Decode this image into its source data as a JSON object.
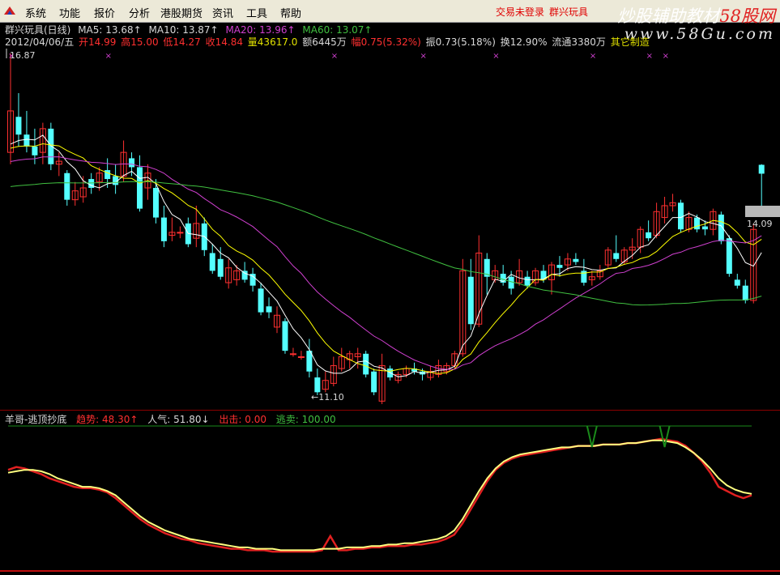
{
  "menu": {
    "items": [
      "系统",
      "功能",
      "报价",
      "分析",
      "港股期货",
      "资讯",
      "工具",
      "帮助"
    ],
    "status": "交易未登录",
    "stock_name": "群兴玩具"
  },
  "watermark": {
    "line1_a": "炒股辅助教材",
    "line1_b": "58股网",
    "line2": "www.58Gu.com"
  },
  "header": {
    "title": "群兴玩具(日线)",
    "ma5": "MA5: 13.68↑",
    "ma10": "MA10: 13.87↑",
    "ma20": "MA20: 13.96↑",
    "ma60": "MA60: 13.07↑"
  },
  "quote": {
    "date": "2012/04/06/五",
    "open": "开14.99",
    "high": "高15.00",
    "low": "低14.27",
    "close": "收14.84",
    "volume": "量43617.0",
    "amount": "额6445万",
    "change": "幅0.75(5.32%)",
    "amplitude": "振0.73(5.18%)",
    "turnover": "换12.90%",
    "float": "流通3380万",
    "sector": "其它制造"
  },
  "price_labels": {
    "high_mark": "16.87",
    "low_mark": "←11.10",
    "current": "14.09"
  },
  "indicator": {
    "name": "羊哥-逃顶抄底",
    "trend": "趋势: 48.30↑",
    "popularity": "人气: 51.80↓",
    "exit": "出击: 0.00",
    "sell": "逃卖: 100.00"
  },
  "colors": {
    "up": "#ff3030",
    "down": "#54ffff",
    "ma5": "#ffffff",
    "ma10": "#ffff00",
    "ma20": "#d040d0",
    "ma60": "#40c040",
    "trend_line": "#e02020",
    "popularity_line": "#ffff80"
  },
  "chart_data": {
    "type": "candlestick",
    "price_range": [
      11.1,
      16.87
    ],
    "candles": [
      {
        "o": 15.2,
        "h": 16.87,
        "l": 15.0,
        "c": 15.9
      },
      {
        "o": 15.8,
        "h": 16.2,
        "l": 15.3,
        "c": 15.5
      },
      {
        "o": 15.5,
        "h": 15.9,
        "l": 15.2,
        "c": 15.3
      },
      {
        "o": 15.3,
        "h": 15.6,
        "l": 15.0,
        "c": 15.15
      },
      {
        "o": 15.2,
        "h": 15.7,
        "l": 15.0,
        "c": 15.6
      },
      {
        "o": 15.6,
        "h": 15.7,
        "l": 14.9,
        "c": 15.0
      },
      {
        "o": 15.0,
        "h": 15.2,
        "l": 14.8,
        "c": 15.05
      },
      {
        "o": 14.85,
        "h": 14.9,
        "l": 14.3,
        "c": 14.4
      },
      {
        "o": 14.4,
        "h": 14.7,
        "l": 14.3,
        "c": 14.55
      },
      {
        "o": 14.45,
        "h": 14.8,
        "l": 14.35,
        "c": 14.6
      },
      {
        "o": 14.75,
        "h": 14.85,
        "l": 14.5,
        "c": 14.6
      },
      {
        "o": 14.7,
        "h": 14.95,
        "l": 14.55,
        "c": 14.85
      },
      {
        "o": 14.9,
        "h": 15.1,
        "l": 14.6,
        "c": 14.75
      },
      {
        "o": 14.8,
        "h": 15.0,
        "l": 14.5,
        "c": 14.65
      },
      {
        "o": 14.8,
        "h": 15.4,
        "l": 14.7,
        "c": 15.2
      },
      {
        "o": 15.1,
        "h": 15.2,
        "l": 14.8,
        "c": 14.95
      },
      {
        "o": 14.95,
        "h": 15.15,
        "l": 14.2,
        "c": 14.25
      },
      {
        "o": 14.6,
        "h": 15.0,
        "l": 14.4,
        "c": 14.85
      },
      {
        "o": 14.6,
        "h": 14.75,
        "l": 14.0,
        "c": 14.1
      },
      {
        "o": 14.1,
        "h": 14.3,
        "l": 13.6,
        "c": 13.7
      },
      {
        "o": 13.8,
        "h": 14.1,
        "l": 13.7,
        "c": 13.85
      },
      {
        "o": 13.85,
        "h": 13.95,
        "l": 13.75,
        "c": 13.85
      },
      {
        "o": 14.0,
        "h": 14.1,
        "l": 13.6,
        "c": 13.65
      },
      {
        "o": 13.75,
        "h": 14.3,
        "l": 13.6,
        "c": 14.0
      },
      {
        "o": 14.0,
        "h": 14.1,
        "l": 13.45,
        "c": 13.55
      },
      {
        "o": 13.5,
        "h": 13.65,
        "l": 13.15,
        "c": 13.2
      },
      {
        "o": 13.4,
        "h": 13.6,
        "l": 13.05,
        "c": 13.1
      },
      {
        "o": 13.0,
        "h": 13.4,
        "l": 12.9,
        "c": 13.25
      },
      {
        "o": 13.05,
        "h": 13.3,
        "l": 12.95,
        "c": 13.2
      },
      {
        "o": 13.2,
        "h": 13.35,
        "l": 13.0,
        "c": 13.05
      },
      {
        "o": 13.15,
        "h": 13.25,
        "l": 12.85,
        "c": 12.95
      },
      {
        "o": 12.9,
        "h": 13.0,
        "l": 12.45,
        "c": 12.5
      },
      {
        "o": 12.6,
        "h": 12.75,
        "l": 12.4,
        "c": 12.5
      },
      {
        "o": 12.25,
        "h": 12.6,
        "l": 12.15,
        "c": 12.45
      },
      {
        "o": 12.35,
        "h": 12.4,
        "l": 11.8,
        "c": 11.85
      },
      {
        "o": 11.8,
        "h": 11.9,
        "l": 11.75,
        "c": 11.8
      },
      {
        "o": 11.75,
        "h": 11.85,
        "l": 11.7,
        "c": 11.75
      },
      {
        "o": 11.85,
        "h": 12.05,
        "l": 11.4,
        "c": 11.5
      },
      {
        "o": 11.4,
        "h": 11.55,
        "l": 11.1,
        "c": 11.15
      },
      {
        "o": 11.2,
        "h": 11.5,
        "l": 11.15,
        "c": 11.35
      },
      {
        "o": 11.3,
        "h": 11.75,
        "l": 11.25,
        "c": 11.6
      },
      {
        "o": 11.55,
        "h": 11.9,
        "l": 11.5,
        "c": 11.75
      },
      {
        "o": 11.7,
        "h": 11.85,
        "l": 11.55,
        "c": 11.8
      },
      {
        "o": 11.75,
        "h": 11.9,
        "l": 11.55,
        "c": 11.8
      },
      {
        "o": 11.8,
        "h": 11.85,
        "l": 11.4,
        "c": 11.45
      },
      {
        "o": 11.5,
        "h": 11.55,
        "l": 11.1,
        "c": 11.15
      },
      {
        "o": 11.0,
        "h": 11.8,
        "l": 10.95,
        "c": 11.6
      },
      {
        "o": 11.55,
        "h": 11.6,
        "l": 11.35,
        "c": 11.4
      },
      {
        "o": 11.35,
        "h": 11.5,
        "l": 11.3,
        "c": 11.45
      },
      {
        "o": 11.45,
        "h": 11.6,
        "l": 11.4,
        "c": 11.55
      },
      {
        "o": 11.55,
        "h": 11.65,
        "l": 11.45,
        "c": 11.5
      },
      {
        "o": 11.5,
        "h": 11.55,
        "l": 11.35,
        "c": 11.45
      },
      {
        "o": 11.4,
        "h": 11.6,
        "l": 11.35,
        "c": 11.5
      },
      {
        "o": 11.45,
        "h": 11.7,
        "l": 11.4,
        "c": 11.6
      },
      {
        "o": 11.5,
        "h": 11.65,
        "l": 11.45,
        "c": 11.6
      },
      {
        "o": 11.6,
        "h": 11.85,
        "l": 11.55,
        "c": 11.8
      },
      {
        "o": 11.8,
        "h": 13.4,
        "l": 11.75,
        "c": 13.2
      },
      {
        "o": 13.1,
        "h": 13.4,
        "l": 12.2,
        "c": 12.3
      },
      {
        "o": 12.3,
        "h": 13.8,
        "l": 12.25,
        "c": 13.5
      },
      {
        "o": 13.4,
        "h": 13.5,
        "l": 12.8,
        "c": 13.1
      },
      {
        "o": 13.05,
        "h": 13.3,
        "l": 13.0,
        "c": 13.2
      },
      {
        "o": 13.15,
        "h": 13.3,
        "l": 12.95,
        "c": 13.0
      },
      {
        "o": 13.1,
        "h": 13.2,
        "l": 12.8,
        "c": 12.9
      },
      {
        "o": 13.0,
        "h": 13.4,
        "l": 12.95,
        "c": 13.2
      },
      {
        "o": 13.1,
        "h": 13.2,
        "l": 12.9,
        "c": 12.95
      },
      {
        "o": 13.0,
        "h": 13.25,
        "l": 12.95,
        "c": 13.2
      },
      {
        "o": 13.2,
        "h": 13.3,
        "l": 13.0,
        "c": 13.05
      },
      {
        "o": 13.05,
        "h": 13.35,
        "l": 12.8,
        "c": 13.3
      },
      {
        "o": 13.3,
        "h": 13.45,
        "l": 13.1,
        "c": 13.25
      },
      {
        "o": 13.3,
        "h": 13.5,
        "l": 13.2,
        "c": 13.4
      },
      {
        "o": 13.4,
        "h": 13.5,
        "l": 13.3,
        "c": 13.35
      },
      {
        "o": 13.2,
        "h": 13.4,
        "l": 12.95,
        "c": 13.0
      },
      {
        "o": 13.05,
        "h": 13.2,
        "l": 12.95,
        "c": 13.1
      },
      {
        "o": 13.1,
        "h": 13.3,
        "l": 13.05,
        "c": 13.2
      },
      {
        "o": 13.3,
        "h": 13.6,
        "l": 13.25,
        "c": 13.55
      },
      {
        "o": 13.5,
        "h": 13.8,
        "l": 13.35,
        "c": 13.4
      },
      {
        "o": 13.35,
        "h": 13.6,
        "l": 13.3,
        "c": 13.55
      },
      {
        "o": 13.55,
        "h": 13.75,
        "l": 13.4,
        "c": 13.6
      },
      {
        "o": 13.6,
        "h": 13.95,
        "l": 13.5,
        "c": 13.9
      },
      {
        "o": 13.85,
        "h": 14.05,
        "l": 13.7,
        "c": 13.75
      },
      {
        "o": 13.8,
        "h": 14.35,
        "l": 13.75,
        "c": 14.2
      },
      {
        "o": 14.1,
        "h": 14.45,
        "l": 14.0,
        "c": 14.3
      },
      {
        "o": 14.3,
        "h": 14.5,
        "l": 14.2,
        "c": 14.35
      },
      {
        "o": 14.35,
        "h": 14.4,
        "l": 13.85,
        "c": 13.9
      },
      {
        "o": 13.9,
        "h": 14.2,
        "l": 13.85,
        "c": 14.1
      },
      {
        "o": 14.1,
        "h": 14.15,
        "l": 13.85,
        "c": 13.9
      },
      {
        "o": 13.95,
        "h": 14.05,
        "l": 13.8,
        "c": 13.9
      },
      {
        "o": 13.9,
        "h": 14.25,
        "l": 13.8,
        "c": 14.2
      },
      {
        "o": 14.15,
        "h": 14.2,
        "l": 13.65,
        "c": 13.7
      },
      {
        "o": 13.75,
        "h": 13.8,
        "l": 13.1,
        "c": 13.15
      },
      {
        "o": 13.05,
        "h": 13.15,
        "l": 12.9,
        "c": 12.95
      },
      {
        "o": 12.95,
        "h": 13.05,
        "l": 12.65,
        "c": 12.7
      },
      {
        "o": 12.7,
        "h": 14.0,
        "l": 12.65,
        "c": 13.9
      },
      {
        "o": 14.99,
        "h": 15.0,
        "l": 14.27,
        "c": 14.84
      }
    ],
    "signals_x_idx": [
      0,
      12,
      40,
      51,
      60,
      72,
      79,
      81
    ],
    "exit_signal_idx": [
      72,
      81
    ],
    "trend_series": [
      70,
      72,
      71,
      69,
      67,
      64,
      62,
      60,
      58,
      57,
      57,
      56,
      54,
      50,
      45,
      40,
      35,
      31,
      28,
      25,
      23,
      21,
      20,
      18,
      17,
      16,
      15,
      14,
      14,
      13,
      13,
      13,
      12,
      12,
      12,
      12,
      12,
      12,
      13,
      23,
      13,
      13,
      14,
      14,
      15,
      15,
      16,
      16,
      16,
      17,
      17,
      18,
      19,
      21,
      24,
      32,
      42,
      52,
      62,
      70,
      75,
      78,
      80,
      81,
      82,
      83,
      84,
      85,
      86,
      87,
      87,
      87,
      88,
      88,
      88,
      89,
      89,
      90,
      91,
      92,
      91,
      90,
      87,
      82,
      76,
      68,
      58,
      55,
      52,
      50,
      52
    ],
    "popularity_series": [
      68,
      69,
      70,
      70,
      69,
      67,
      64,
      62,
      60,
      58,
      58,
      57,
      55,
      52,
      47,
      42,
      37,
      33,
      30,
      27,
      25,
      23,
      21,
      20,
      19,
      18,
      17,
      16,
      15,
      15,
      14,
      14,
      14,
      13,
      13,
      13,
      13,
      13,
      14,
      14,
      14,
      15,
      15,
      15,
      16,
      16,
      17,
      17,
      18,
      18,
      19,
      20,
      21,
      23,
      27,
      35,
      45,
      55,
      64,
      71,
      76,
      79,
      81,
      82,
      83,
      84,
      85,
      86,
      86,
      87,
      87,
      87,
      88,
      88,
      88,
      89,
      89,
      90,
      91,
      91,
      90,
      89,
      86,
      82,
      77,
      71,
      64,
      59,
      56,
      54,
      53
    ]
  }
}
